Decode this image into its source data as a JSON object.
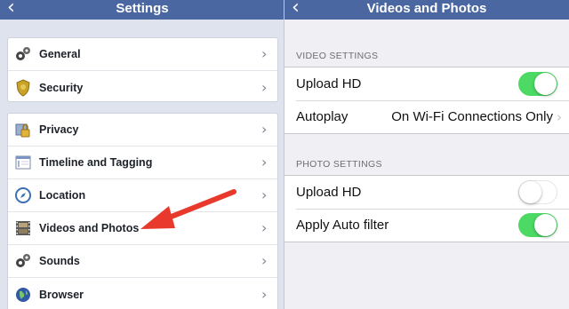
{
  "left_pane": {
    "title": "Settings",
    "back_icon": "chevron-left-icon",
    "group1": [
      {
        "id": "general",
        "label": "General",
        "icon": "gears-icon"
      },
      {
        "id": "security",
        "label": "Security",
        "icon": "badge-icon"
      }
    ],
    "group2": [
      {
        "id": "privacy",
        "label": "Privacy",
        "icon": "lock-icon"
      },
      {
        "id": "timeline",
        "label": "Timeline and Tagging",
        "icon": "timeline-icon"
      },
      {
        "id": "location",
        "label": "Location",
        "icon": "compass-icon"
      },
      {
        "id": "videos",
        "label": "Videos and Photos",
        "icon": "film-icon"
      },
      {
        "id": "sounds",
        "label": "Sounds",
        "icon": "gears-icon"
      },
      {
        "id": "browser",
        "label": "Browser",
        "icon": "globe-icon"
      }
    ]
  },
  "right_pane": {
    "title": "Videos and Photos",
    "back_icon": "chevron-left-icon",
    "video_section": {
      "header": "VIDEO SETTINGS",
      "upload_hd_label": "Upload HD",
      "upload_hd_on": true,
      "autoplay_label": "Autoplay",
      "autoplay_value": "On Wi-Fi Connections Only"
    },
    "photo_section": {
      "header": "PHOTO SETTINGS",
      "upload_hd_label": "Upload HD",
      "upload_hd_on": false,
      "auto_filter_label": "Apply Auto filter",
      "auto_filter_on": true
    }
  },
  "colors": {
    "nav_blue": "#4b67a1",
    "toggle_green": "#4cd964",
    "annotation_arrow": "#e8392c"
  }
}
